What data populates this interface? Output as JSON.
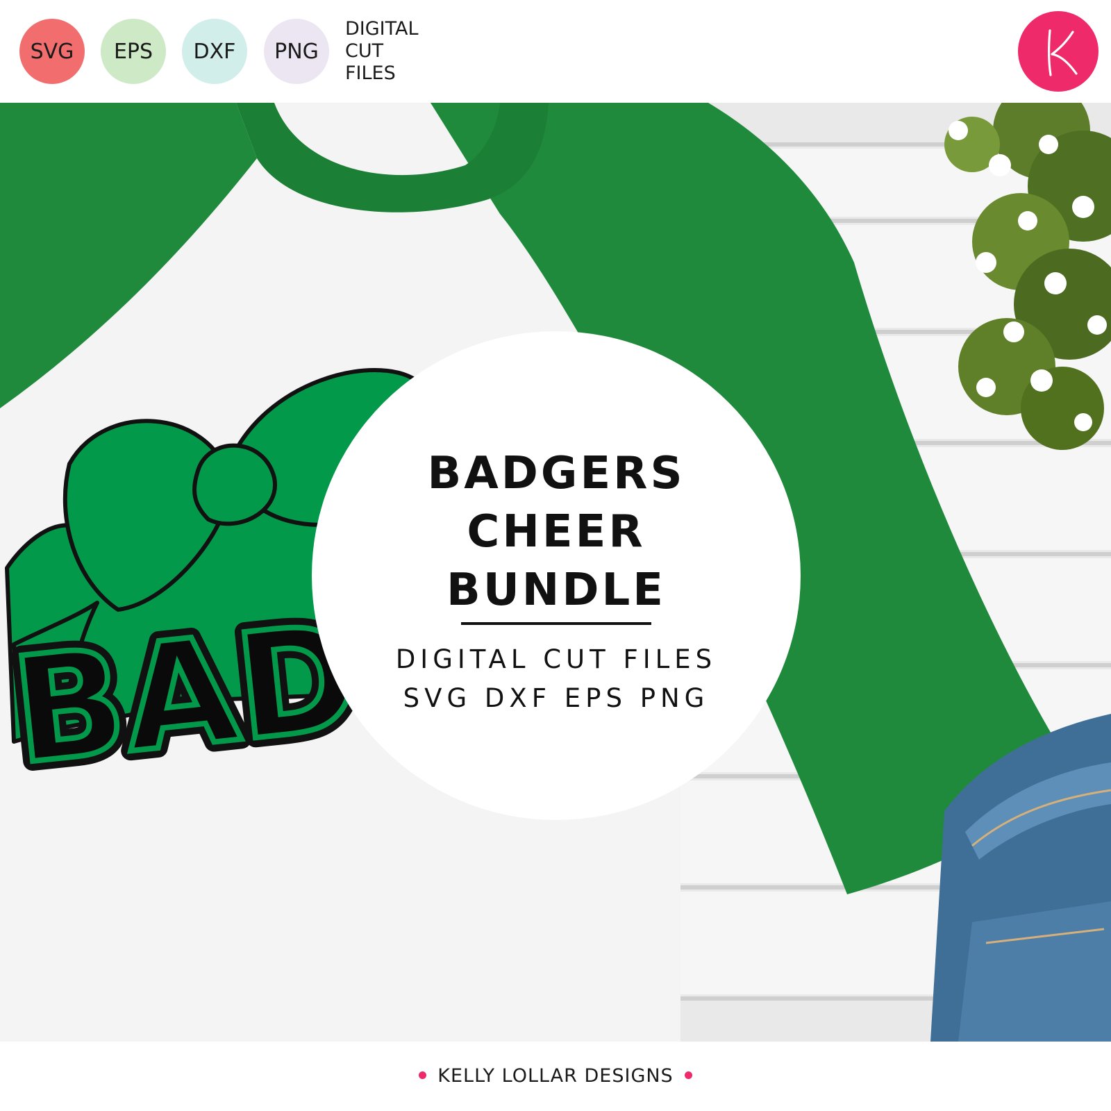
{
  "header": {
    "badges": [
      {
        "label": "SVG",
        "color": "#f26d6d"
      },
      {
        "label": "EPS",
        "color": "#cde9c6"
      },
      {
        "label": "DXF",
        "color": "#d2eeea"
      },
      {
        "label": "PNG",
        "color": "#ece6f2"
      }
    ],
    "caption_lines": [
      "DIGITAL",
      "CUT",
      "FILES"
    ],
    "logo_letter": "K",
    "logo_color": "#ee2a6b"
  },
  "design": {
    "word_fragment": "BADG",
    "shirt_color": "#1f8a3c",
    "bow_color": "#03994a"
  },
  "title_circle": {
    "title_lines": [
      "BADGERS",
      "CHEER",
      "BUNDLE"
    ],
    "subtitle_lines": [
      "DIGITAL CUT FILES",
      "SVG DXF EPS PNG"
    ]
  },
  "footer": {
    "credit": "KELLY LOLLAR DESIGNS",
    "dot_color": "#ee2a6b"
  }
}
